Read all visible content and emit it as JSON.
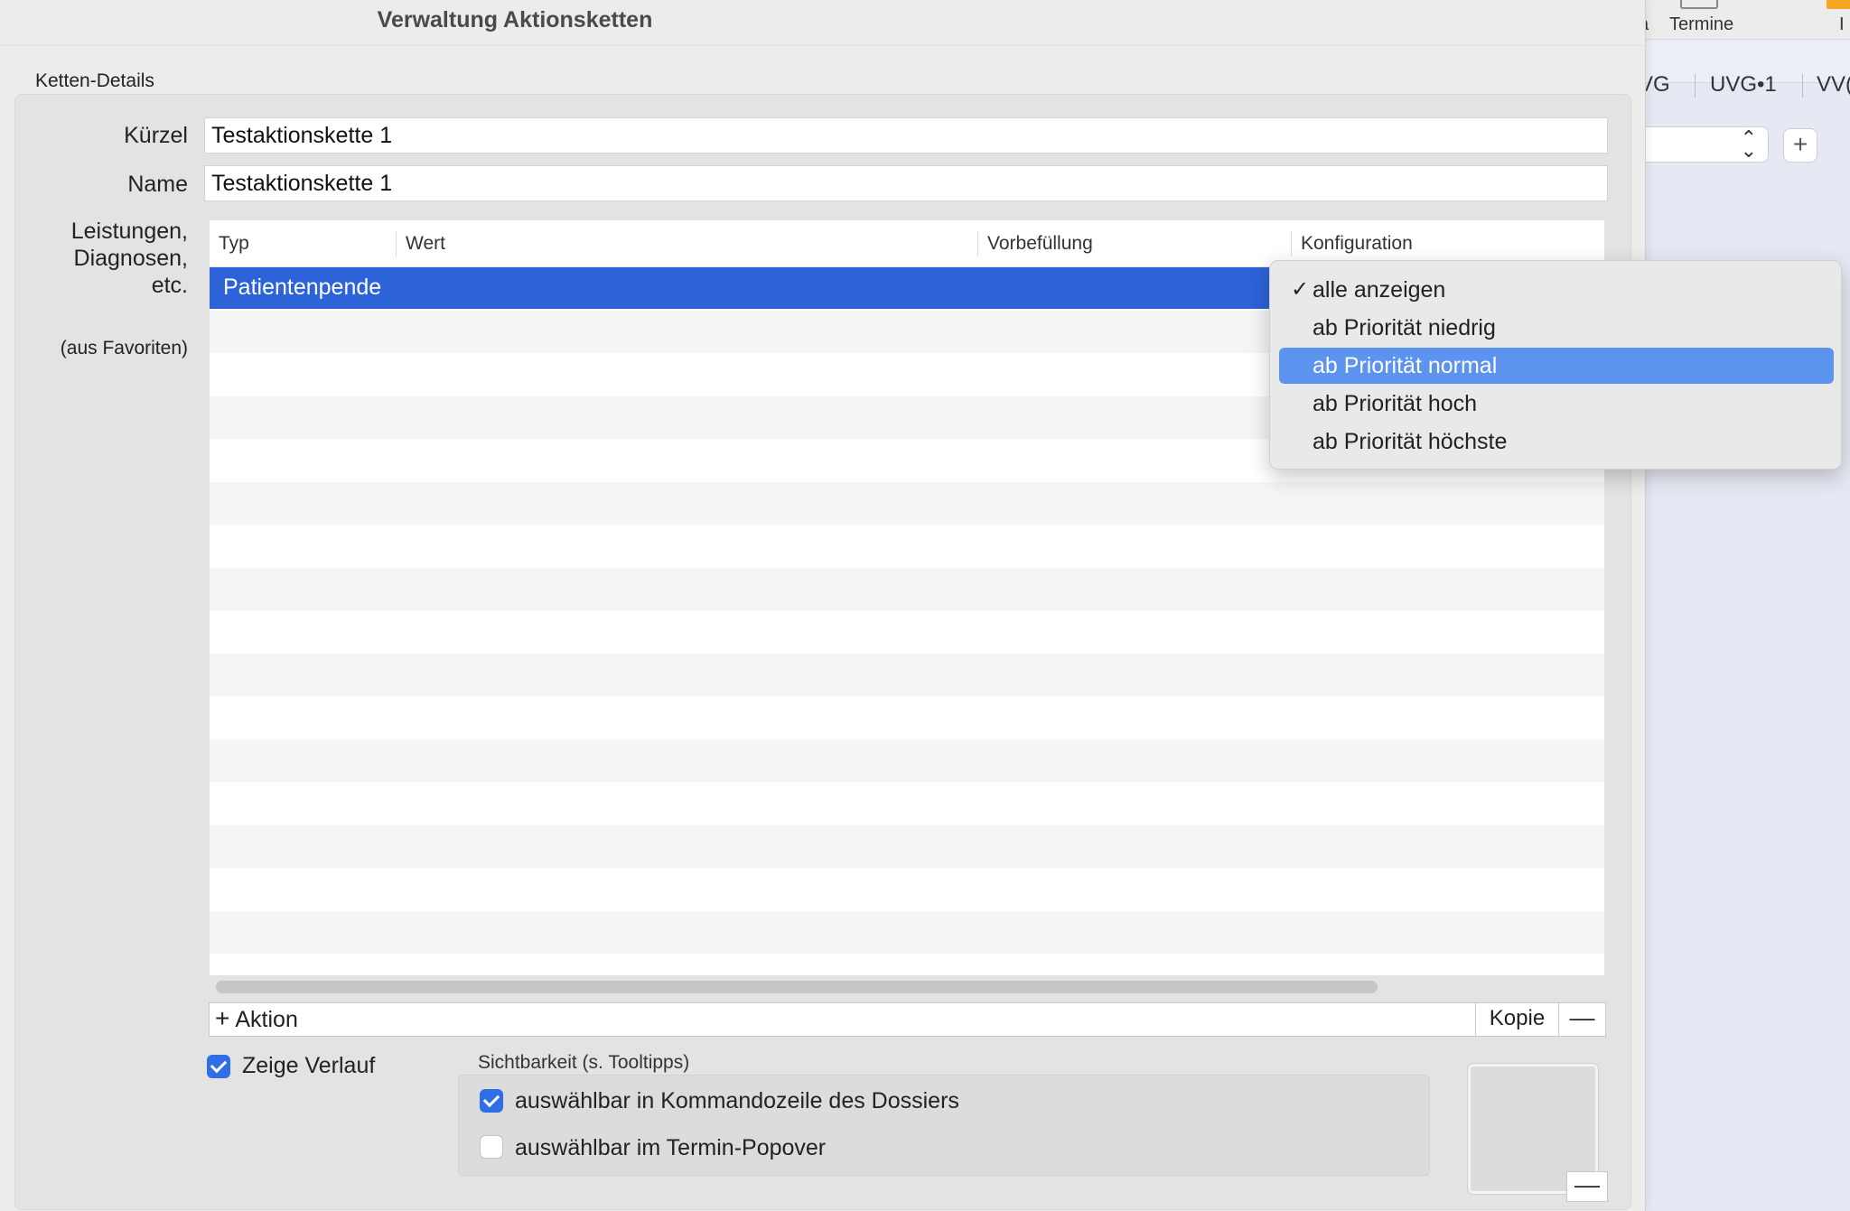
{
  "window": {
    "title": "Verwaltung Aktionsketten"
  },
  "group": {
    "label": "Ketten-Details"
  },
  "fields": {
    "kuerzel_label": "Kürzel",
    "kuerzel_value": "Testaktionskette 1",
    "name_label": "Name",
    "name_value": "Testaktionskette 1",
    "leistungen_label": [
      "Leistungen,",
      "Diagnosen,",
      "etc."
    ],
    "favoriten_label": "(aus Favoriten)"
  },
  "table": {
    "columns": [
      "Typ",
      "Wert",
      "Vorbefüllung",
      "Konfiguration"
    ],
    "rows": [
      {
        "typ": "Patientenpende",
        "wert": "",
        "vorbefuellung": "",
        "konfiguration": "",
        "selected": true
      }
    ]
  },
  "actions": {
    "add_label": "Aktion",
    "copy_label": "Kopie",
    "remove_label": "—"
  },
  "options": {
    "verlauf_label": "Zeige Verlauf",
    "verlauf_checked": true,
    "sichtbarkeit_label": "Sichtbarkeit (s. Tooltipps)",
    "kommando_label": "auswählbar in Kommandozeile des Dossiers",
    "kommando_checked": true,
    "termin_label": "auswählbar im Termin-Popover",
    "termin_checked": false
  },
  "image_well": {
    "remove_label": "—"
  },
  "dropdown": {
    "items": [
      {
        "label": "alle anzeigen",
        "checked": true,
        "highlighted": false
      },
      {
        "label": "ab Priorität niedrig",
        "checked": false,
        "highlighted": false
      },
      {
        "label": "ab Priorität normal",
        "checked": false,
        "highlighted": true
      },
      {
        "label": "ab Priorität hoch",
        "checked": false,
        "highlighted": false
      },
      {
        "label": "ab Priorität höchste",
        "checked": false,
        "highlighted": false
      }
    ]
  },
  "background_app": {
    "toolbar_fragment": "a",
    "toolbar_termine": "Termine",
    "toolbar_more": "I",
    "tabs": [
      "VG",
      "UVG•1",
      "VV("
    ],
    "plus_label": "+"
  },
  "colors": {
    "selection": "#2c63d8",
    "menu_highlight": "#5b93ee",
    "checkbox_on": "#2f6ee6"
  }
}
